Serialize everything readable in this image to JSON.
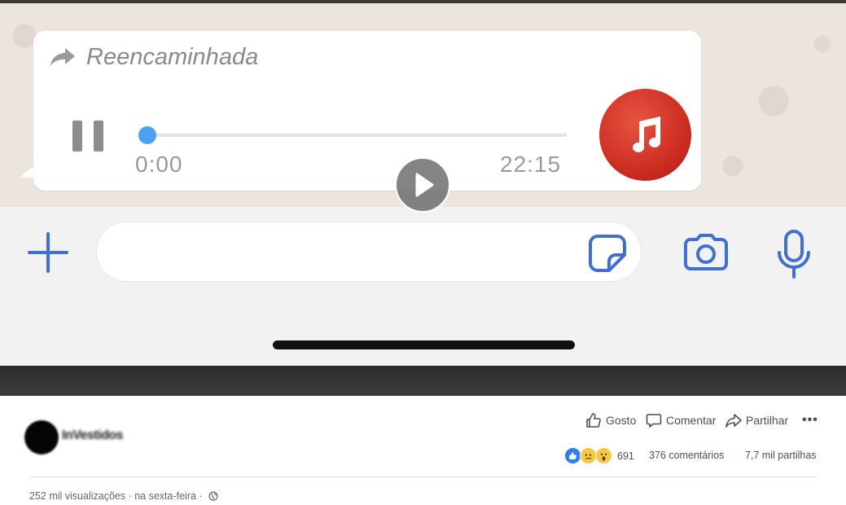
{
  "video": {
    "forwarded_label": "Reencaminhada",
    "audio_time_current": "0:00",
    "audio_time_total": "22:15",
    "audio_progress": 0.0,
    "icons": [
      "forward-arrow-icon",
      "pause-icon",
      "music-note-icon",
      "play-icon",
      "plus-icon",
      "sticker-icon",
      "camera-icon",
      "microphone-icon"
    ]
  },
  "post": {
    "author_name": "InVestidos",
    "actions": {
      "like_label": "Gosto",
      "comment_label": "Comentar",
      "share_label": "Partilhar",
      "more_label": "•••"
    },
    "stats": {
      "reaction_count": "691",
      "comments": "376 comentários",
      "shares": "7,7 mil partilhas"
    },
    "meta": {
      "views": "252 mil visualizações",
      "separator1": " · ",
      "time": "na sexta-feira",
      "separator2": " · "
    }
  },
  "colors": {
    "accent_blue": "#4aa1ee",
    "icon_blue": "#3f6fd0",
    "music_red": "#c8281e",
    "like_blue": "#2f7ff2"
  }
}
